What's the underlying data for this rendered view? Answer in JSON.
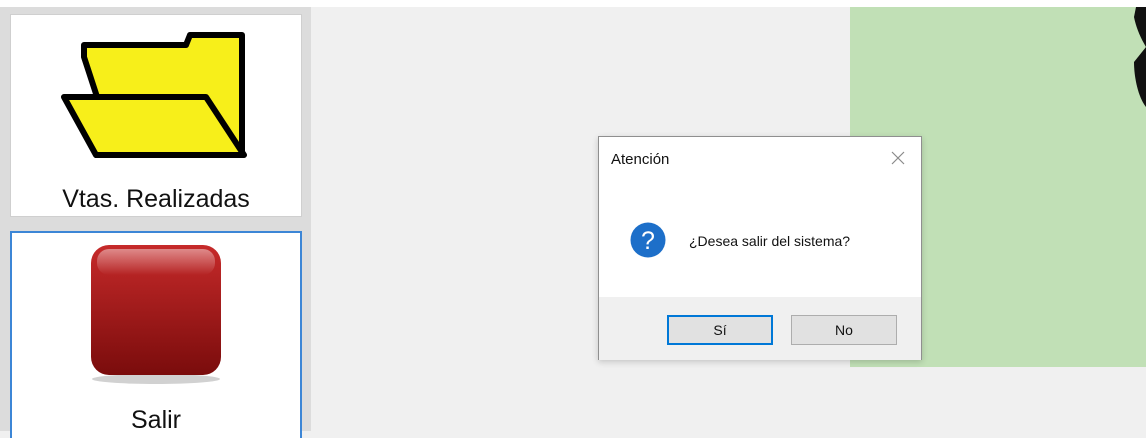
{
  "sidebar": {
    "tiles": [
      {
        "label": "Vtas. Realizadas",
        "icon": "folder-icon"
      },
      {
        "label": "Salir",
        "icon": "exit-stop-icon"
      }
    ]
  },
  "dialog": {
    "title": "Atención",
    "message": "¿Desea salir del sistema?",
    "icon": "question-icon",
    "buttons": {
      "yes": "Sí",
      "no": "No"
    }
  },
  "colors": {
    "background": "#f0f0f0",
    "green_panel": "#c1e0b6",
    "folder_yellow": "#f7ef1a",
    "exit_red": "#b01c1c",
    "focus_blue": "#0078d7",
    "question_blue": "#1d6fc9"
  }
}
